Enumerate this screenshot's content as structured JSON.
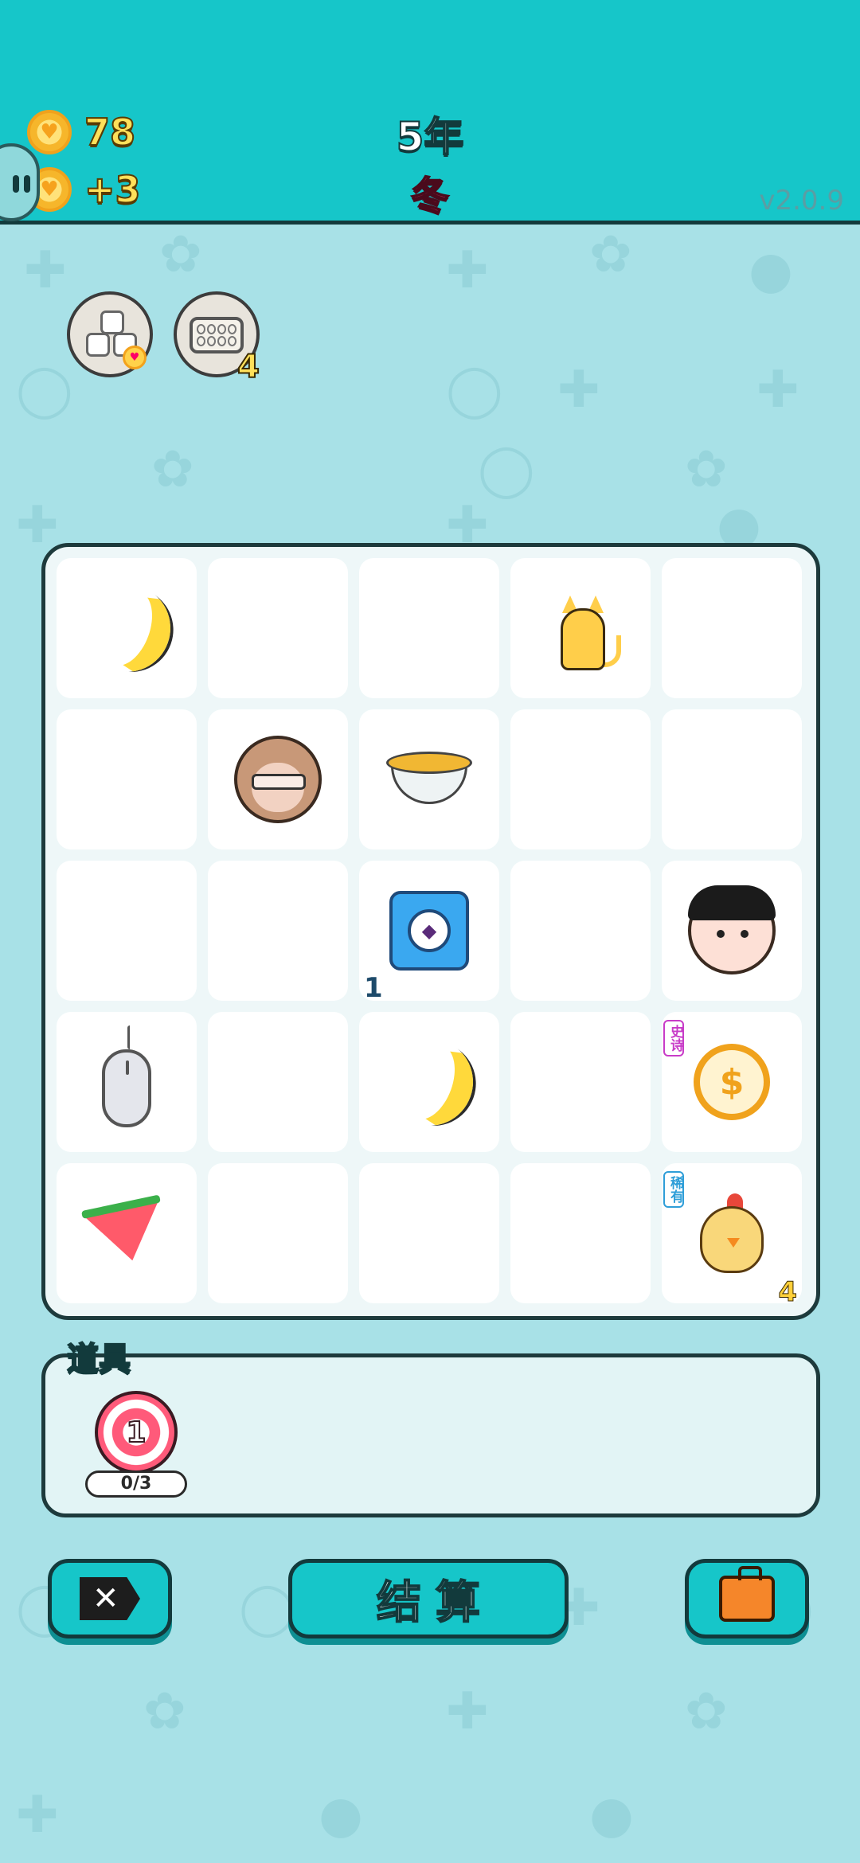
{
  "header": {
    "coins_value": "78",
    "income_value": "+3",
    "year_label": "5年",
    "season_label": "冬",
    "version": "v2.0.9"
  },
  "top_buttons": {
    "egg_tray_count": "4"
  },
  "grid": {
    "rows": 5,
    "cols": 5,
    "cells": [
      {
        "row": 1,
        "col": 1,
        "item": "banana-icon"
      },
      {
        "row": 1,
        "col": 4,
        "item": "cat-icon"
      },
      {
        "row": 2,
        "col": 2,
        "item": "monkey-icon"
      },
      {
        "row": 2,
        "col": 3,
        "item": "soup-bowl-icon"
      },
      {
        "row": 3,
        "col": 3,
        "item": "timer-card-icon",
        "count": "1"
      },
      {
        "row": 3,
        "col": 5,
        "item": "human-face-icon"
      },
      {
        "row": 4,
        "col": 1,
        "item": "computer-mouse-icon"
      },
      {
        "row": 4,
        "col": 3,
        "item": "banana-icon"
      },
      {
        "row": 4,
        "col": 5,
        "item": "coin-icon",
        "tag": "史诗"
      },
      {
        "row": 5,
        "col": 1,
        "item": "watermelon-icon"
      },
      {
        "row": 5,
        "col": 5,
        "item": "chick-icon",
        "tag": "稀有",
        "count": "4"
      }
    ]
  },
  "props": {
    "title": "道具",
    "items": [
      {
        "icon": "target-icon",
        "value": "1",
        "progress": "0/3"
      }
    ]
  },
  "buttons": {
    "close_label": "✕",
    "settle_label": "结算",
    "bag_icon": "briefcase-icon"
  },
  "colors": {
    "header": "#16c6c9",
    "background": "#a8e1e7",
    "gold": "#ffe05a",
    "epic_tag": "#c83cc8",
    "rare_tag": "#2f9ed8"
  }
}
